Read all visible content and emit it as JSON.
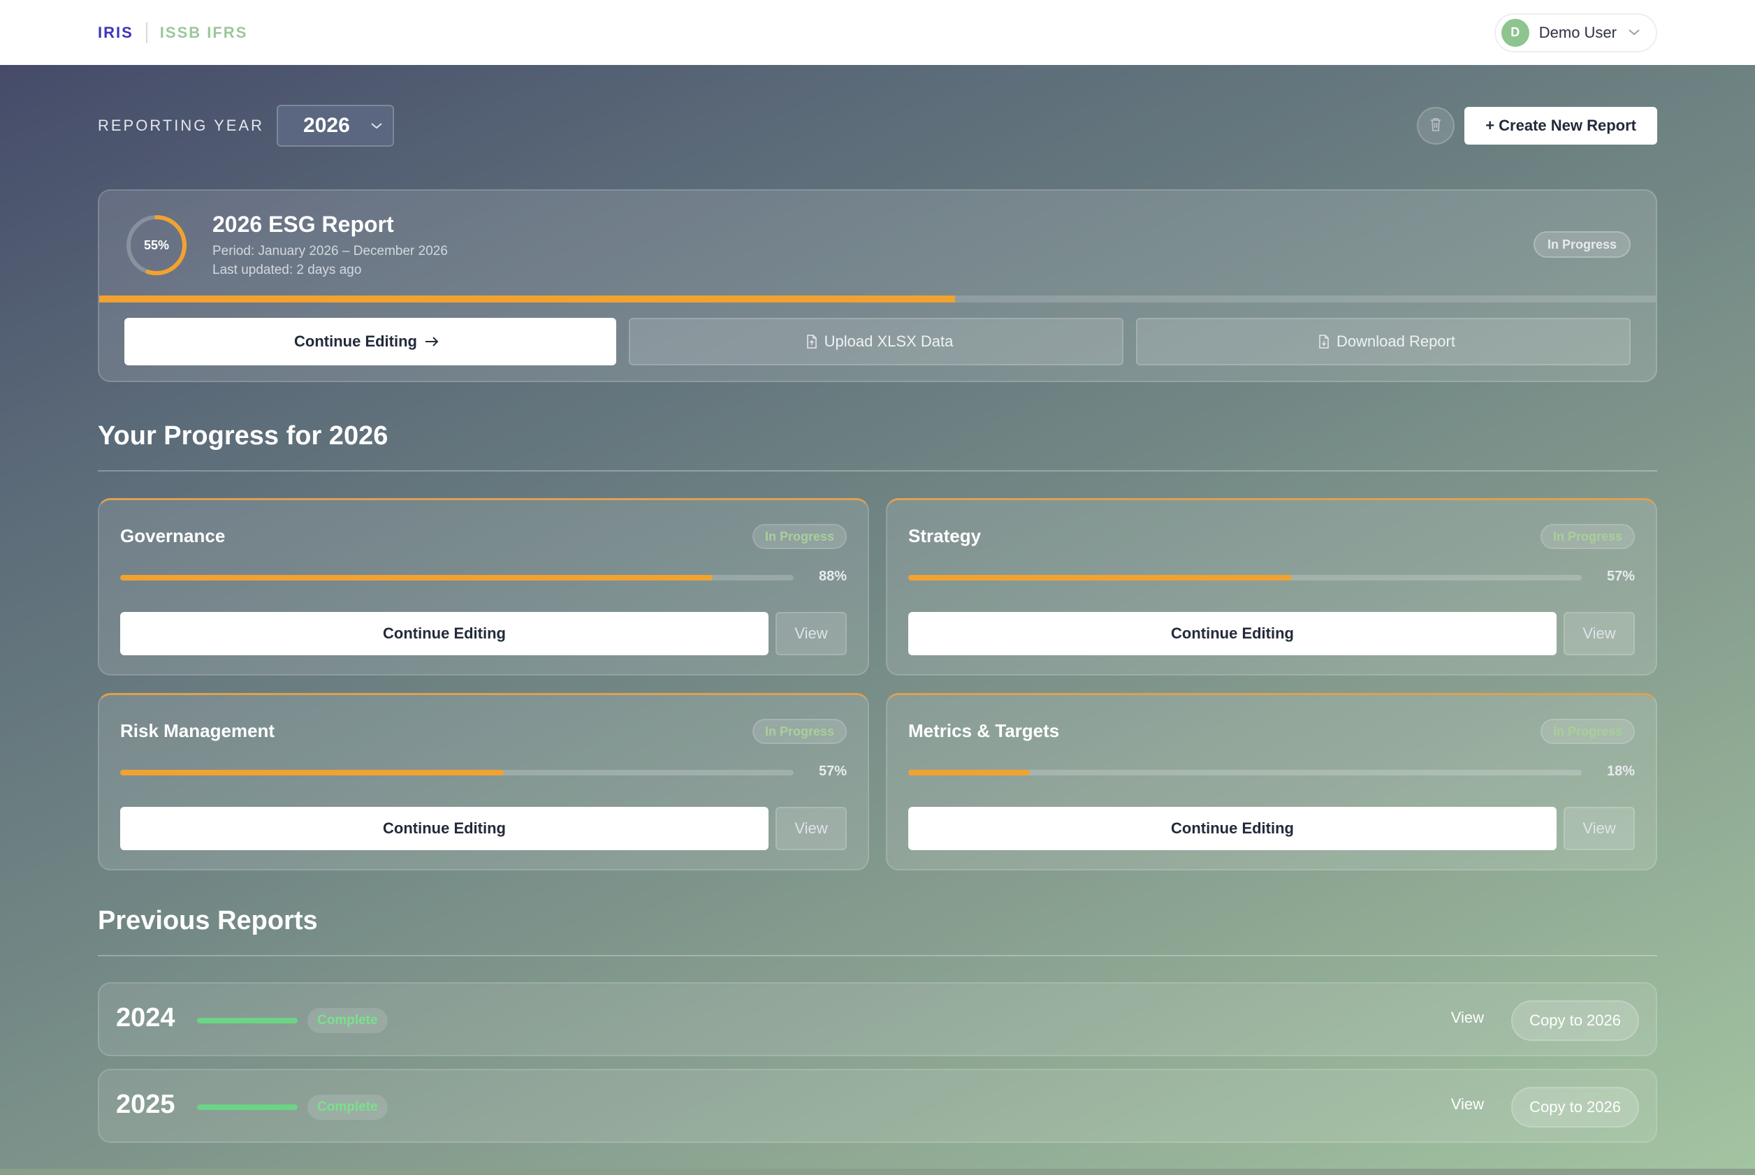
{
  "header": {
    "brand_primary": "IRIS",
    "brand_secondary": "ISSB IFRS",
    "user": {
      "initial": "D",
      "name": "Demo User"
    }
  },
  "toolbar": {
    "year_label": "REPORTING YEAR",
    "year_value": "2026",
    "create_label": "+ Create New Report"
  },
  "current_report": {
    "progress_label": "55%",
    "progress": 0.55,
    "title": "2026 ESG Report",
    "period": "Period: January 2026 – December 2026",
    "updated": "Last updated: 2 days ago",
    "status": "In Progress",
    "continue_label": "Continue Editing",
    "upload_label": "Upload XLSX Data",
    "download_label": "Download Report"
  },
  "progress_section": {
    "title": "Your Progress for 2026",
    "pillars": [
      {
        "name": "Governance",
        "status": "In Progress",
        "percent_label": "88%",
        "progress": 0.88,
        "edit_label": "Continue Editing",
        "view_label": "View"
      },
      {
        "name": "Strategy",
        "status": "In Progress",
        "percent_label": "57%",
        "progress": 0.57,
        "edit_label": "Continue Editing",
        "view_label": "View"
      },
      {
        "name": "Risk Management",
        "status": "In Progress",
        "percent_label": "57%",
        "progress": 0.57,
        "edit_label": "Continue Editing",
        "view_label": "View"
      },
      {
        "name": "Metrics & Targets",
        "status": "In Progress",
        "percent_label": "18%",
        "progress": 0.18,
        "edit_label": "Continue Editing",
        "view_label": "View"
      }
    ]
  },
  "previous_section": {
    "title": "Previous Reports",
    "reports": [
      {
        "year": "2024",
        "status": "Complete",
        "progress": 1.0,
        "view_label": "View",
        "copy_label": "Copy to 2026"
      },
      {
        "year": "2025",
        "status": "Complete",
        "progress": 1.0,
        "view_label": "View",
        "copy_label": "Copy to 2026"
      }
    ]
  },
  "colors": {
    "accent_orange": "#f2a230",
    "complete_green": "#6cd486",
    "brand_indigo": "#3d34b8",
    "brand_green": "#9cc79c"
  },
  "icons": {
    "user_menu": "chevron-down-icon",
    "year_select": "chevron-down-icon",
    "delete": "trash-icon",
    "continue": "arrow-right-icon",
    "upload": "file-icon",
    "download": "file-icon"
  }
}
